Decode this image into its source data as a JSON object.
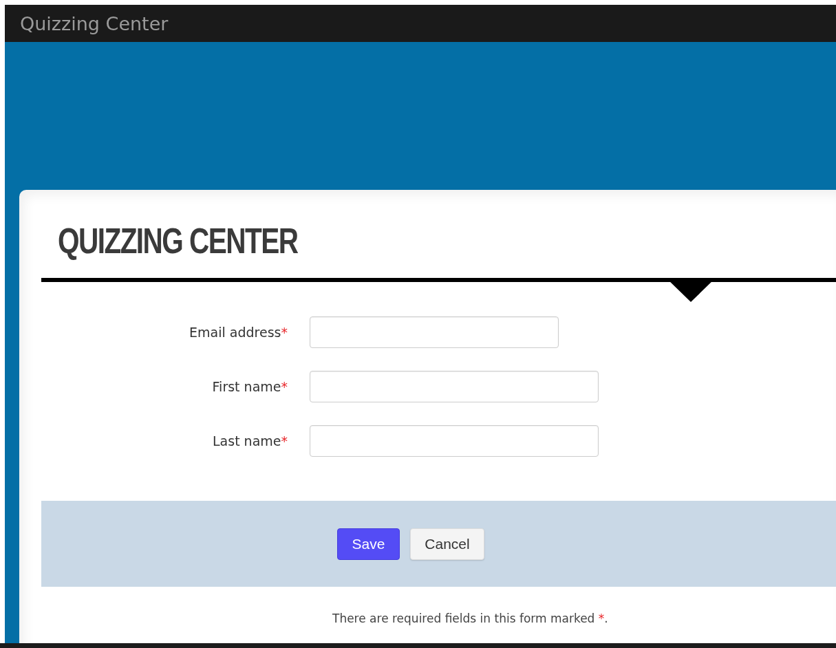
{
  "top_bar": {
    "title": "Quizzing Center"
  },
  "card": {
    "heading": "QUIZZING CENTER",
    "fields": [
      {
        "kind": "short",
        "label": "Email address",
        "mark": "*"
      },
      {
        "kind": "long",
        "label": "First name",
        "mark": "*"
      },
      {
        "kind": "long",
        "label": "Last name",
        "mark": "*"
      }
    ],
    "buttons": [
      {
        "kind": "primary",
        "label": "Save"
      },
      {
        "kind": "secondary",
        "label": "Cancel"
      }
    ],
    "note": {
      "text": "There are required fields in this form marked",
      "mark": "*",
      "end": "."
    }
  }
}
